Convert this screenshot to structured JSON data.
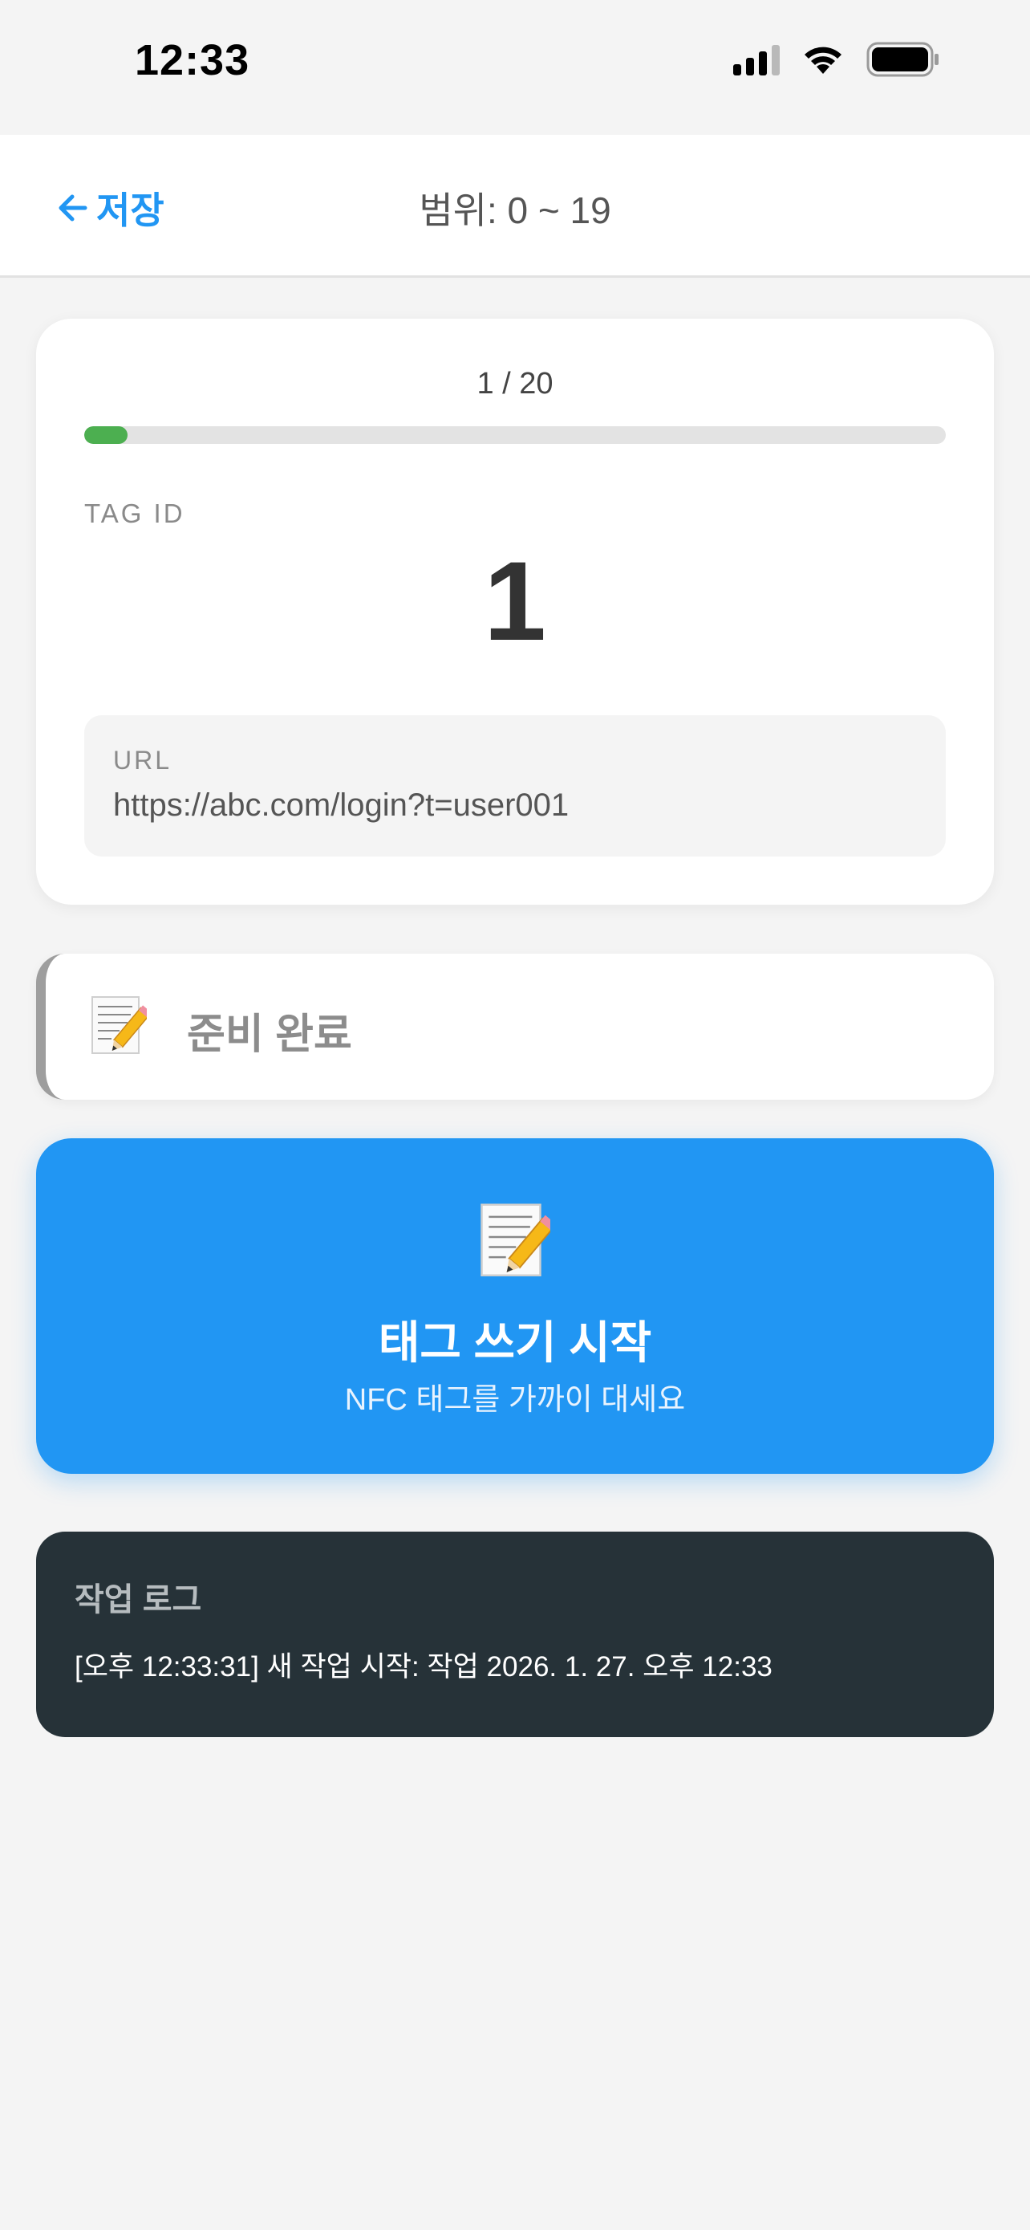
{
  "status_bar": {
    "time": "12:33"
  },
  "header": {
    "back_label": "저장",
    "title": "범위: 0 ~ 19"
  },
  "progress": {
    "text": "1 / 20",
    "current": 1,
    "total": 20,
    "fill_percent": 5,
    "tag_id_label": "TAG ID",
    "tag_id_value": "1",
    "url_label": "URL",
    "url_value": "https://abc.com/login?t=user001"
  },
  "status": {
    "icon": "memo-pencil-icon",
    "label": "준비 완료"
  },
  "start_button": {
    "icon": "memo-pencil-icon",
    "title": "태그 쓰기 시작",
    "subtitle": "NFC 태그를 가까이 대세요"
  },
  "log": {
    "title": "작업 로그",
    "entries": [
      "[오후 12:33:31] 새 작업 시작: 작업 2026. 1. 27. 오후 12:33"
    ]
  },
  "colors": {
    "accent": "#2196f3",
    "progress_fill": "#4caf50",
    "log_bg": "#263238",
    "status_border": "#9e9e9e"
  }
}
